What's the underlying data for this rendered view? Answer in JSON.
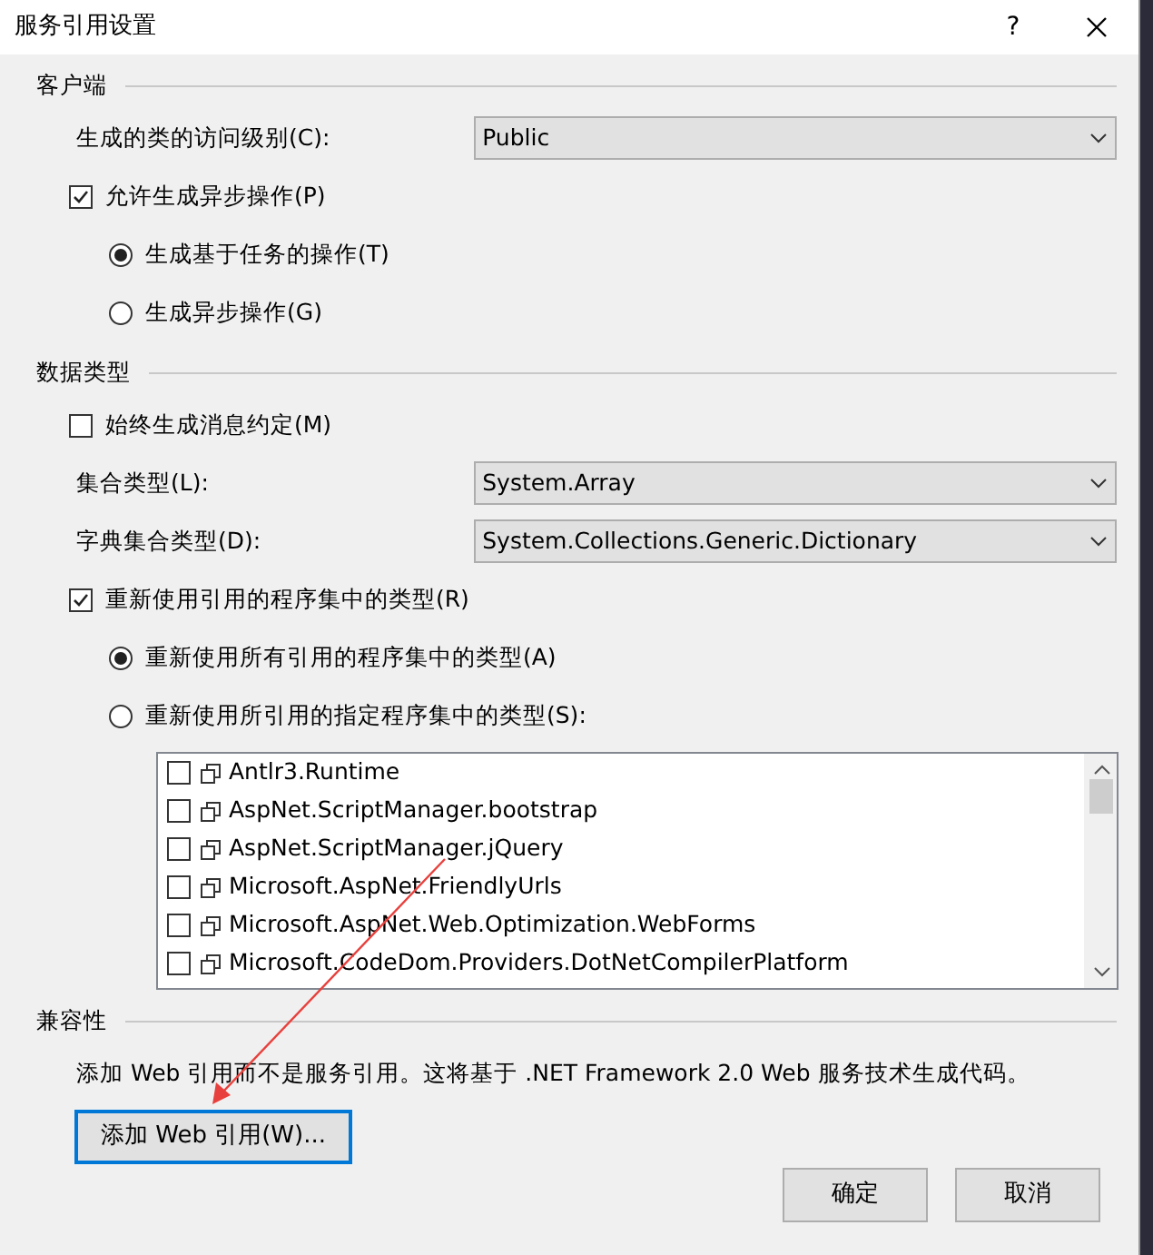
{
  "window": {
    "title": "服务引用设置",
    "help": "?"
  },
  "sections": [
    {
      "title": "客户端",
      "items": [
        {
          "kind": "select",
          "label": "生成的类的访问级别(C):",
          "value": "Public"
        },
        {
          "kind": "checkbox",
          "label": "允许生成异步操作(P)",
          "checked": true
        },
        {
          "kind": "radio",
          "label": "生成基于任务的操作(T)",
          "selected": true
        },
        {
          "kind": "radio",
          "label": "生成异步操作(G)",
          "selected": false
        }
      ]
    },
    {
      "title": "数据类型",
      "items": [
        {
          "kind": "checkbox",
          "label": "始终生成消息约定(M)",
          "checked": false
        },
        {
          "kind": "select",
          "label": "集合类型(L):",
          "value": "System.Array"
        },
        {
          "kind": "select",
          "label": "字典集合类型(D):",
          "value": "System.Collections.Generic.Dictionary"
        },
        {
          "kind": "checkbox",
          "label": "重新使用引用的程序集中的类型(R)",
          "checked": true
        },
        {
          "kind": "radio",
          "label": "重新使用所有引用的程序集中的类型(A)",
          "selected": true
        },
        {
          "kind": "radio",
          "label": "重新使用所引用的指定程序集中的类型(S):",
          "selected": false
        },
        {
          "kind": "list",
          "entries": [
            {
              "label": "Antlr3.Runtime",
              "checked": false
            },
            {
              "label": "AspNet.ScriptManager.bootstrap",
              "checked": false
            },
            {
              "label": "AspNet.ScriptManager.jQuery",
              "checked": false
            },
            {
              "label": "Microsoft.AspNet.FriendlyUrls",
              "checked": false
            },
            {
              "label": "Microsoft.AspNet.Web.Optimization.WebForms",
              "checked": false
            },
            {
              "label": "Microsoft.CodeDom.Providers.DotNetCompilerPlatform",
              "checked": false
            }
          ]
        }
      ]
    },
    {
      "title": "兼容性",
      "items": [
        {
          "kind": "text",
          "label": "添加 Web 引用而不是服务引用。这将基于 .NET Framework 2.0 Web 服务技术生成代码。"
        },
        {
          "kind": "button",
          "label": "添加 Web 引用(W)..."
        }
      ]
    }
  ],
  "buttons": [
    "确定",
    "取消"
  ]
}
